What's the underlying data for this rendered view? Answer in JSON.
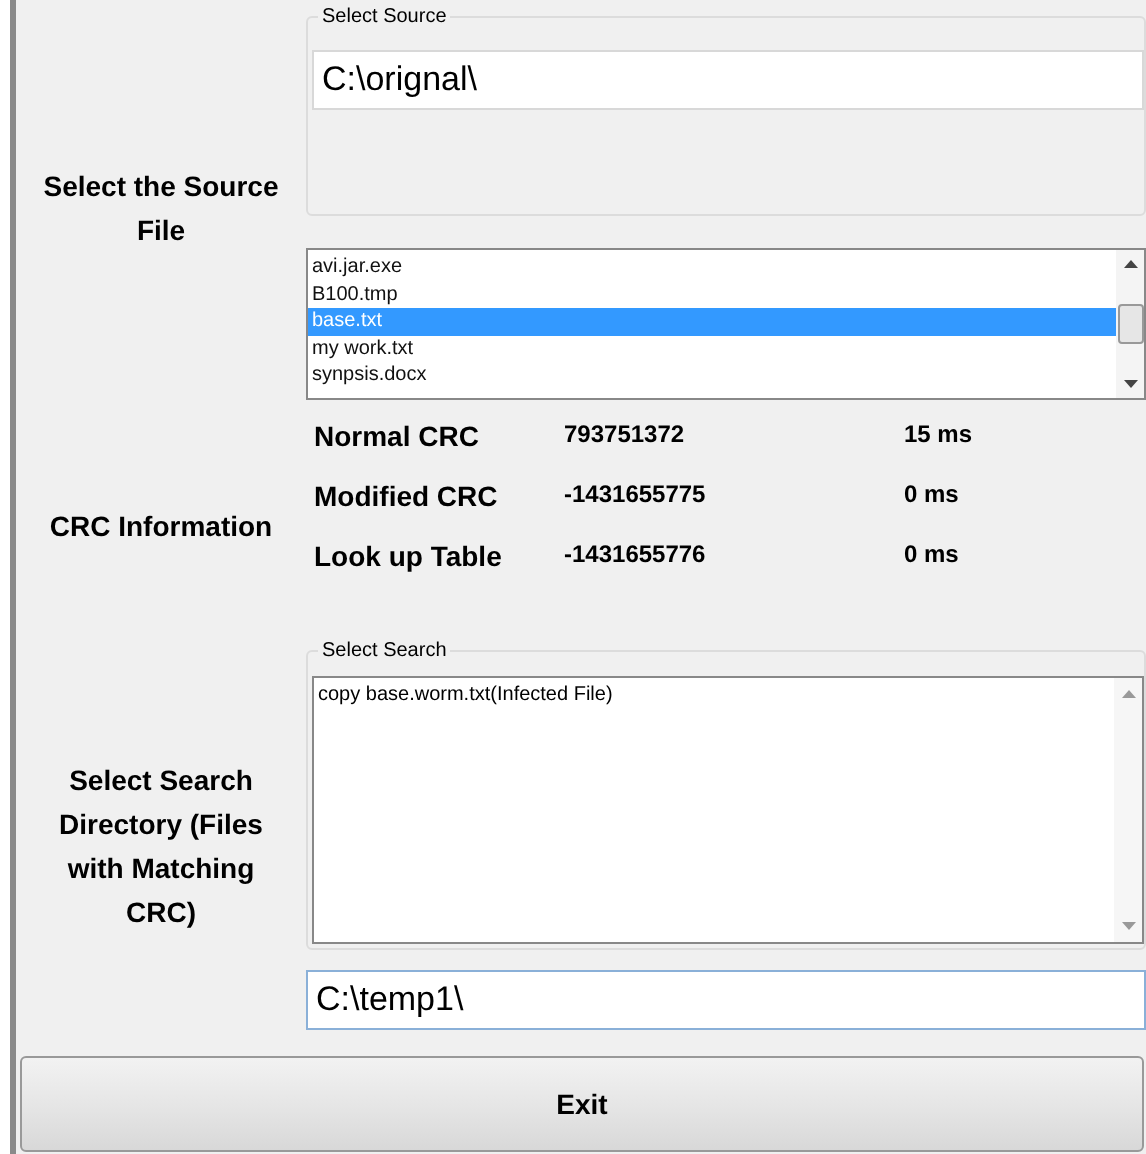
{
  "source": {
    "label": "Select the Source File",
    "group_title": "Select Source",
    "path": "C:\\orignal\\",
    "files": [
      {
        "name": "avi.jar.exe",
        "selected": false
      },
      {
        "name": "B100.tmp",
        "selected": false
      },
      {
        "name": "base.txt",
        "selected": true
      },
      {
        "name": "my work.txt",
        "selected": false
      },
      {
        "name": "synpsis.docx",
        "selected": false
      }
    ]
  },
  "crc": {
    "label": "CRC Information",
    "rows": [
      {
        "name": "Normal CRC",
        "value": "793751372",
        "time": "15 ms"
      },
      {
        "name": "Modified CRC",
        "value": "-1431655775",
        "time": "0 ms"
      },
      {
        "name": "Look up Table",
        "value": "-1431655776",
        "time": "0 ms"
      }
    ]
  },
  "search": {
    "label": "Select Search Directory (Files with Matching CRC)",
    "group_title": "Select Search",
    "results": "copy base.worm.txt(Infected File)",
    "directory": "C:\\temp1\\"
  },
  "exit_button": "Exit"
}
